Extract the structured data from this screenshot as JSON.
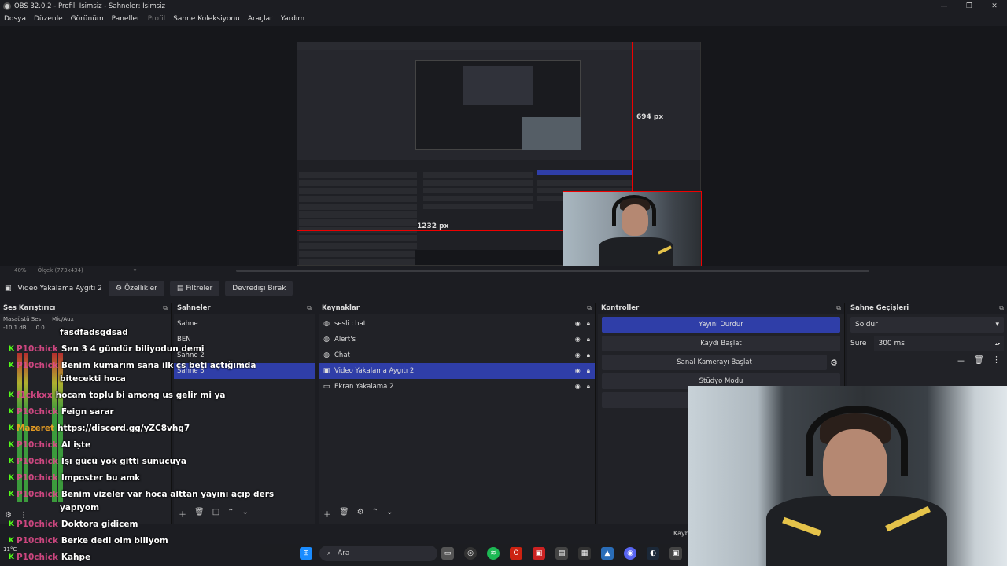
{
  "window": {
    "title": "OBS 32.0.2 - Profil: İsimsiz - Sahneler: İsimsiz",
    "min": "—",
    "max": "❐",
    "close": "✕"
  },
  "menu": [
    "Dosya",
    "Düzenle",
    "Görünüm",
    "Paneller",
    "Profil",
    "Sahne Koleksiyonu",
    "Araçlar",
    "Yardım"
  ],
  "preview": {
    "width_label": "694 px",
    "height_label": "1232 px",
    "zoom": "40%",
    "scale": "Ölçek (773x434)"
  },
  "toolbar": {
    "source_name": "Video Yakalama Aygıtı 2",
    "properties": "Özellikler",
    "filters": "Filtreler",
    "deactivate": "Devredışı Bırak"
  },
  "audio_mixer": {
    "title": "Ses Karıştırıcı",
    "desktop": "Masaüstü Ses",
    "mic": "Mic/Aux",
    "db1": "-10.1 dB",
    "db2": "0.0"
  },
  "scenes": {
    "title": "Sahneler",
    "items": [
      "Sahne",
      "BEN",
      "Sahne 2",
      "Sahne 3"
    ],
    "selected_index": 3
  },
  "sources": {
    "title": "Kaynaklar",
    "items": [
      {
        "name": "sesli chat",
        "icon": "globe-icon"
      },
      {
        "name": "Alert's",
        "icon": "globe-icon"
      },
      {
        "name": "Chat",
        "icon": "globe-icon"
      },
      {
        "name": "Video Yakalama Aygıtı 2",
        "icon": "camera-icon"
      },
      {
        "name": "Ekran Yakalama 2",
        "icon": "monitor-icon"
      }
    ],
    "selected_index": 3
  },
  "controls": {
    "title": "Kontroller",
    "stop_stream": "Yayını Durdur",
    "start_record": "Kaydı Başlat",
    "virtual_cam": "Sanal Kamerayı Başlat",
    "studio_mode": "Stüdyo Modu"
  },
  "transitions": {
    "title": "Sahne Geçişleri",
    "type": "Soldur",
    "duration_label": "Süre",
    "duration": "300 ms"
  },
  "chat": [
    {
      "user": "",
      "msg": "fasdfadsgdsad"
    },
    {
      "user": "P10chick",
      "msg": "Sen 3 4 gündür biliyodun demi"
    },
    {
      "user": "P10chick",
      "msg": "Benim kumarım sana ilk cs beti açtığımda"
    },
    {
      "user": "",
      "msg": "bitecekti hoca"
    },
    {
      "user": "f1ckkxx",
      "msg": "hocam toplu bi among us gelir mi ya"
    },
    {
      "user": "P10chick",
      "msg": "Feign sarar"
    },
    {
      "user": "Mazeret",
      "msg": "https://discord.gg/yZC8vhg7"
    },
    {
      "user": "P10chick",
      "msg": "Al işte"
    },
    {
      "user": "P10chick",
      "msg": "Işı gücü yok gitti sunucuya"
    },
    {
      "user": "P10chick",
      "msg": "Imposter bu amk"
    },
    {
      "user": "P10chick",
      "msg": "Benim vizeler var hoca alttan yayını açıp ders"
    },
    {
      "user": "",
      "msg": "yapıyom"
    },
    {
      "user": "P10chick",
      "msg": "Doktora gidicem"
    },
    {
      "user": "P10chick",
      "msg": "Berke dedi olm biliyom"
    },
    {
      "user": "P10chick",
      "msg": "Kahpe"
    }
  ],
  "taskbar": {
    "search": "Ara",
    "weather": "11°C"
  },
  "status": {
    "dropped": "Kayb"
  }
}
